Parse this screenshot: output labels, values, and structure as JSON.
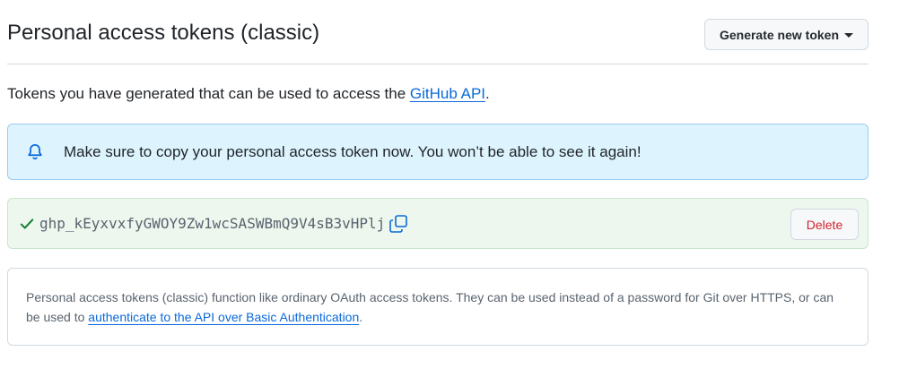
{
  "header": {
    "title": "Personal access tokens (classic)",
    "generate_button_label": "Generate new token"
  },
  "intro": {
    "text": "Tokens you have generated that can be used to access the ",
    "link_text": "GitHub API",
    "suffix": "."
  },
  "flash": {
    "icon": "bell-icon",
    "message": "Make sure to copy your personal access token now. You won’t be able to see it again!"
  },
  "token": {
    "status_icon": "check-icon",
    "value": "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",
    "copy_icon": "copy-icon",
    "delete_label": "Delete"
  },
  "info": {
    "text": "Personal access tokens (classic) function like ordinary OAuth access tokens. They can be used instead of a password for Git over HTTPS, or can be used to ",
    "link_text": "authenticate to the API over Basic Authentication",
    "suffix": "."
  },
  "colors": {
    "link": "#0969da",
    "flash_bg": "#ddf4ff",
    "success_bg": "#eef7ee",
    "success_icon": "#1a7f37",
    "danger": "#d1242f"
  }
}
